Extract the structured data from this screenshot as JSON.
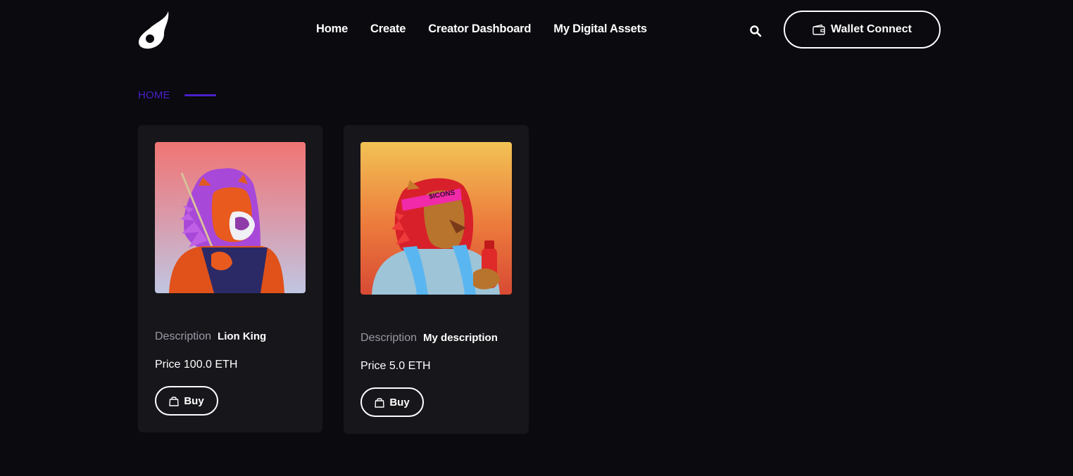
{
  "header": {
    "logo_icon": "flame-drop-logo",
    "nav": [
      {
        "label": "Home"
      },
      {
        "label": "Create"
      },
      {
        "label": "Creator Dashboard"
      },
      {
        "label": "My Digital Assets"
      }
    ],
    "search_icon": "search-icon",
    "wallet_button": {
      "label": "Wallet Connect",
      "icon": "wallet-icon"
    }
  },
  "breadcrumb": {
    "label": "HOME",
    "accent": "#4b1fc8"
  },
  "cards": [
    {
      "image": "lion-purple-mane-artwork",
      "description_label": "Description",
      "description_value": "Lion King",
      "price": "Price 100.0 ETH",
      "buy_label": "Buy",
      "buy_icon": "shopping-bag-icon"
    },
    {
      "image": "lion-red-mane-headband-artwork",
      "description_label": "Description",
      "description_value": "My description",
      "price": "Price 5.0 ETH",
      "buy_label": "Buy",
      "buy_icon": "shopping-bag-icon"
    }
  ]
}
